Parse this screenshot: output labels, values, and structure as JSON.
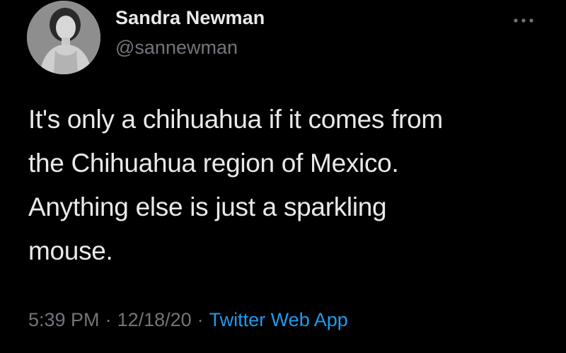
{
  "author": {
    "name": "Sandra Newman",
    "handle": "@sannewman"
  },
  "tweet": {
    "text_lines": [
      "It's only a chihuahua if it comes from",
      "the Chihuahua region of Mexico.",
      "Anything else is just a sparkling",
      "mouse."
    ],
    "time": "5:39 PM",
    "separator": "·",
    "date": "12/18/20",
    "source": "Twitter Web App"
  },
  "icons": {
    "avatar": "profile-photo",
    "more": "more-horizontal-icon"
  },
  "colors": {
    "background": "#000000",
    "text": "#e7e9ea",
    "secondary_text": "#71767b",
    "link": "#1d9bf0"
  }
}
